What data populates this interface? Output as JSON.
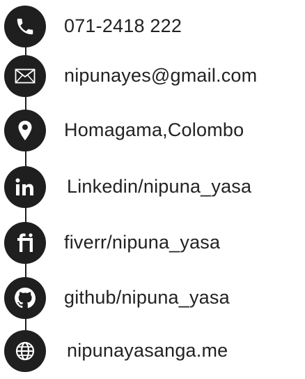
{
  "contacts": {
    "phone": "071-2418 222",
    "email": "nipunayes@gmail.com",
    "location": "Homagama,Colombo",
    "linkedin": "Linkedin/nipuna_yasa",
    "fiverr": "fiverr/nipuna_yasa",
    "github": "github/nipuna_yasa",
    "website": "nipunayasanga.me"
  },
  "icons": {
    "phone": "phone-icon",
    "email": "envelope-icon",
    "location": "map-pin-icon",
    "linkedin": "linkedin-icon",
    "fiverr": "fiverr-icon",
    "github": "github-icon",
    "website": "globe-icon"
  },
  "colors": {
    "icon_bg": "#1f1f1f",
    "text": "#222222",
    "background": "#ffffff"
  }
}
